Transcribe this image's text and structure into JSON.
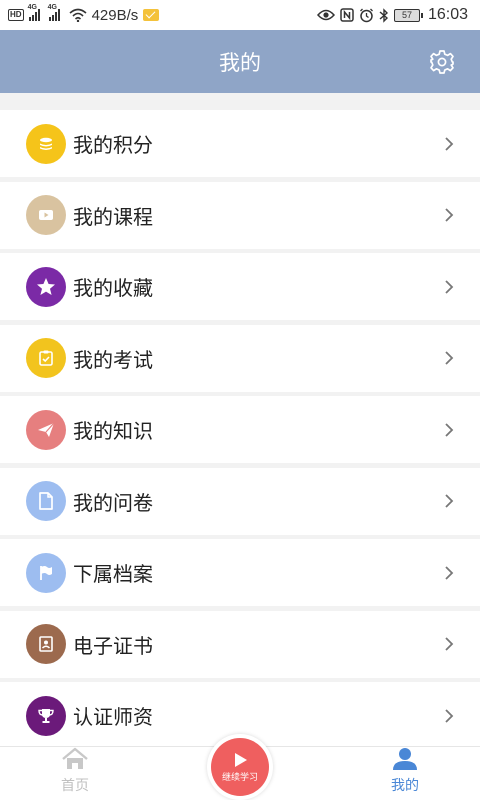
{
  "status_bar": {
    "hd": "HD",
    "signal1_label": "4G",
    "signal2_label": "4G",
    "net_speed": "429B/s",
    "battery": "57",
    "time": "16:03"
  },
  "header": {
    "title": "我的",
    "settings_icon": "gear-icon"
  },
  "menu": [
    {
      "label": "我的积分",
      "icon": "coins-icon",
      "color": "#f5c41a"
    },
    {
      "label": "我的课程",
      "icon": "video-icon",
      "color": "#d9c3a0"
    },
    {
      "label": "我的收藏",
      "icon": "star-icon",
      "color": "#7b2aa6"
    },
    {
      "label": "我的考试",
      "icon": "checklist-icon",
      "color": "#f2c41e"
    },
    {
      "label": "我的知识",
      "icon": "paper-plane-icon",
      "color": "#e67f7f"
    },
    {
      "label": "我的问卷",
      "icon": "document-icon",
      "color": "#9dbdf0"
    },
    {
      "label": "下属档案",
      "icon": "flag-icon",
      "color": "#9dbdf0"
    },
    {
      "label": "电子证书",
      "icon": "certificate-icon",
      "color": "#9c6a4e"
    },
    {
      "label": "认证师资",
      "icon": "trophy-icon",
      "color": "#6b1a7a"
    }
  ],
  "bottom_nav": {
    "home_label": "首页",
    "play_label": "继续学习",
    "mine_label": "我的",
    "active_color": "#4a87d6",
    "inactive_color": "#c0c0c0",
    "play_color": "#ef5f5f"
  }
}
